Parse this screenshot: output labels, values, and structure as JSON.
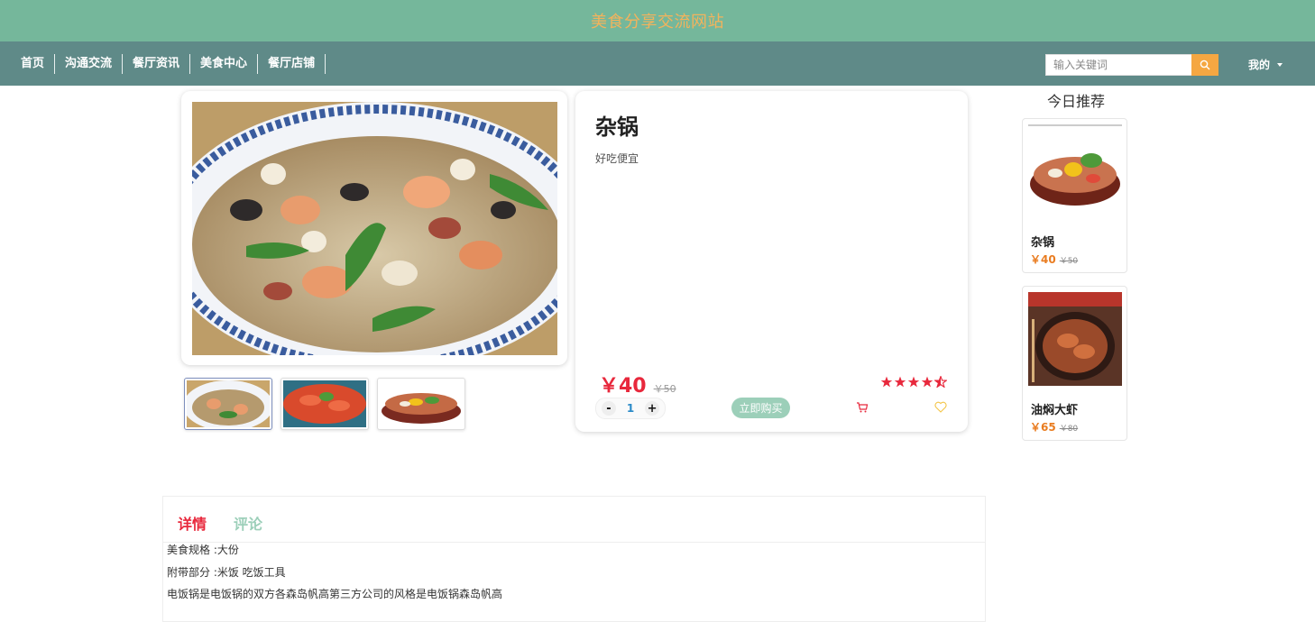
{
  "site": {
    "title": "美食分享交流网站"
  },
  "nav": {
    "items": [
      "首页",
      "沟通交流",
      "餐厅资讯",
      "美食中心",
      "餐厅店铺"
    ]
  },
  "search": {
    "placeholder": "输入关键词"
  },
  "user_menu": {
    "label": "我的"
  },
  "product": {
    "name": "杂锅",
    "description": "好吃便宜",
    "price": "￥40",
    "original_price": "￥50",
    "rating": 4.5,
    "quantity": "1",
    "buy_label": "立即购买"
  },
  "recommend": {
    "title": "今日推荐",
    "items": [
      {
        "name": "杂锅",
        "price": "￥40",
        "original_price": "￥50"
      },
      {
        "name": "油焖大虾",
        "price": "￥65",
        "original_price": "￥80"
      }
    ]
  },
  "detail": {
    "tabs": [
      "详情",
      "评论"
    ],
    "lines": [
      "美食规格 :大份",
      "附带部分 :米饭 吃饭工具",
      "电饭锅是电饭锅的双方各森岛帆高第三方公司的风格是电饭锅森岛帆高"
    ]
  },
  "colors": {
    "header": "#75b79b",
    "nav": "#5f8a88",
    "title_text": "#f3b35c",
    "price_red": "#e8283c",
    "accent_green": "#9ccfb9",
    "search_button": "#f5a742"
  }
}
